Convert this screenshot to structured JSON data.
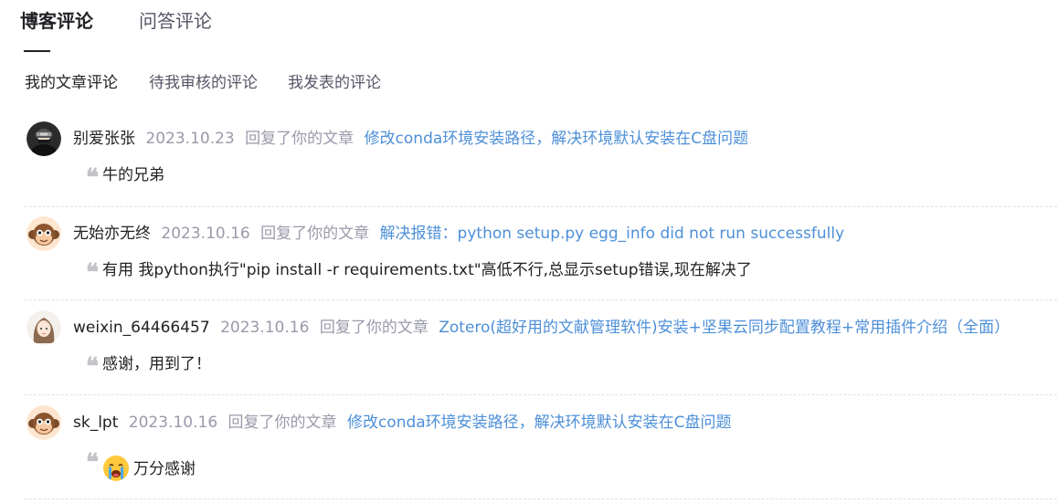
{
  "main_tabs": [
    {
      "label": "博客评论",
      "active": true
    },
    {
      "label": "问答评论",
      "active": false
    }
  ],
  "sub_tabs": [
    {
      "label": "我的文章评论",
      "active": true
    },
    {
      "label": "待我审核的评论",
      "active": false
    },
    {
      "label": "我发表的评论",
      "active": false
    }
  ],
  "comments": [
    {
      "user": "别爱张张",
      "date": "2023.10.23",
      "action": "回复了你的文章",
      "article": "修改conda环境安装路径，解决环境默认安装在C盘问题",
      "text": "牛的兄弟",
      "avatar": "dark-character-avatar-icon"
    },
    {
      "user": "无始亦无终",
      "date": "2023.10.16",
      "action": "回复了你的文章",
      "article": "解决报错：python setup.py egg_info did not run successfully",
      "text": "有用 我python执行\"pip install -r requirements.txt\"高低不行,总显示setup错误,现在解决了",
      "avatar": "monkey-avatar-icon"
    },
    {
      "user": "weixin_64466457",
      "date": "2023.10.16",
      "action": "回复了你的文章",
      "article": "Zotero(超好用的文献管理软件)安装+坚果云同步配置教程+常用插件介绍（全面）",
      "text": "感谢，用到了！",
      "avatar": "girl-avatar-icon"
    },
    {
      "user": "sk_lpt",
      "date": "2023.10.16",
      "action": "回复了你的文章",
      "article": "修改conda环境安装路径，解决环境默认安装在C盘问题",
      "text": "万分感谢",
      "avatar": "monkey-avatar-icon",
      "emoji": "crying-face-emoji-icon"
    }
  ],
  "colors": {
    "link": "#4d8fd8",
    "muted": "#999aaa",
    "text": "#222226",
    "quote": "#c4c4c8"
  }
}
